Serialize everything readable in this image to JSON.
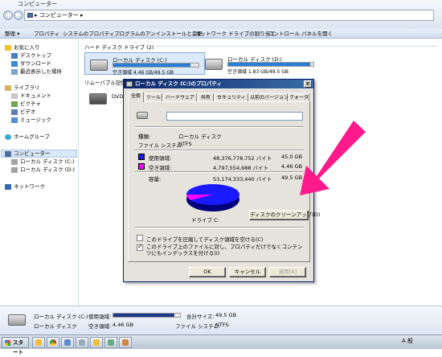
{
  "window": {
    "title": "コンピューター",
    "address": "▸ コンピューター ▸"
  },
  "toolbar": {
    "organize": "整理 ▾",
    "properties": "プロパティ",
    "system_properties": "システムのプロパティ",
    "uninstall": "プログラムのアンインストールと変更",
    "map_drive": "ネットワーク ドライブの割り当て",
    "control_panel": "コントロール パネルを開く"
  },
  "sidebar": {
    "favorites": "お気に入り",
    "desktop": "デスクトップ",
    "downloads": "ダウンロード",
    "recent": "最近表示した場所",
    "libraries": "ライブラリ",
    "documents": "ドキュメント",
    "pictures": "ピクチャ",
    "videos": "ビデオ",
    "music": "ミュージック",
    "homegroup": "ホームグループ",
    "computer": "コンピューター",
    "drive_c": "ローカル ディスク (C:)",
    "drive_d": "ローカル ディスク (D:)",
    "network": "ネットワーク"
  },
  "main": {
    "hdd_group": "ハード ディスク ドライブ (2)",
    "removable_group": "リムーバブル記憶域があるデバイス (1)",
    "drives": [
      {
        "name": "ローカル ディスク (C:)",
        "free": "空き領域 4.46 GB/49.5 GB",
        "used_fraction": 0.91
      },
      {
        "name": "ローカル ディスク (D:)",
        "free": "空き領域 1.83 GB/49.5 GB",
        "used_fraction": 0.96
      }
    ],
    "dvd_label": "DVD"
  },
  "dialog": {
    "title": "ローカル ディスク (C:)のプロパティ",
    "tabs": [
      "全般",
      "ツール",
      "ハードウェア",
      "共有",
      "セキュリティ",
      "以前のバージョン",
      "クォータ"
    ],
    "type_label": "種類:",
    "type_value": "ローカル ディスク",
    "fs_label": "ファイル システム:",
    "fs_value": "NTFS",
    "used_label": "使用領域:",
    "used_bytes": "48,376,778,752 バイト",
    "used_gb": "45.0 GB",
    "free_label": "空き領域:",
    "free_bytes": "4,797,554,688 バイト",
    "free_gb": "4.46 GB",
    "capacity_label": "容量:",
    "capacity_bytes": "53,174,333,440 バイト",
    "capacity_gb": "49.5 GB",
    "drive_label": "ドライブ C:",
    "cleanup_button": "ディスクのクリーンアップ(D)",
    "compress_label": "このドライブを圧縮してディスク領域を空ける(C)",
    "index_label": "このドライブ上のファイルに対し、プロパティだけでなくコンテンツにもインデックスを付ける(I)",
    "ok": "OK",
    "cancel": "キャンセル",
    "apply": "適用(A)",
    "used_color": "#1a1aff",
    "free_color": "#ff00ff"
  },
  "details": {
    "name": "ローカル ディスク (C:)",
    "type": "ローカル ディスク",
    "used_label": "使用領域:",
    "free_label": "空き領域:",
    "free_value": "4.46 GB",
    "total_label": "合計サイズ:",
    "total_value": "49.5 GB",
    "fs_label": "ファイル システム:",
    "fs_value": "NTFS",
    "used_fraction": 0.91
  },
  "taskbar": {
    "start": "スタート",
    "lang": "A 般"
  },
  "annotation": {
    "arrow_color": "#ff1a8c"
  }
}
